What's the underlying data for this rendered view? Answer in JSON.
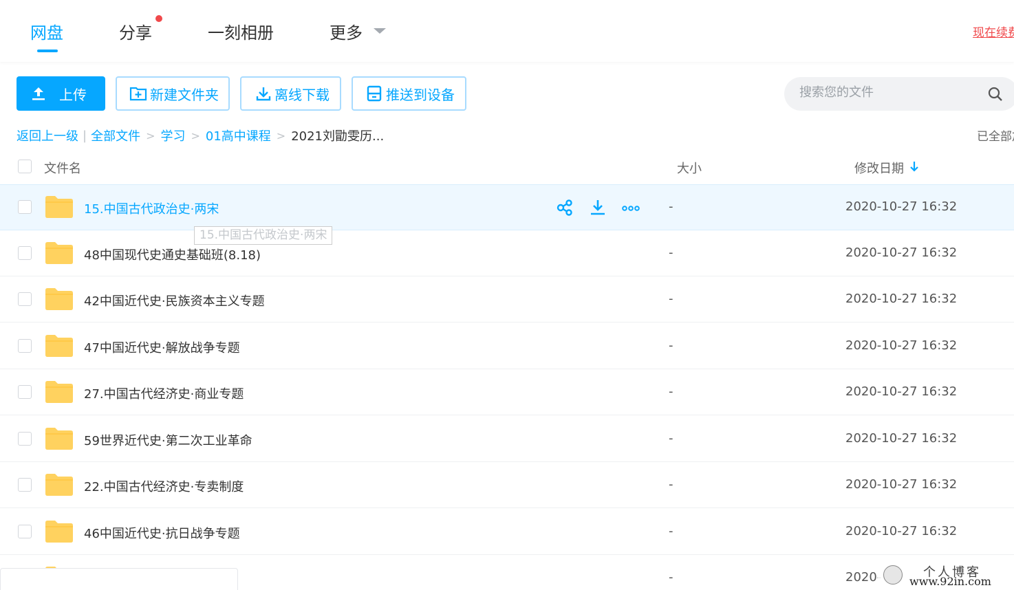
{
  "nav": {
    "tabs": [
      {
        "label": "网盘"
      },
      {
        "label": "分享"
      },
      {
        "label": "一刻相册"
      },
      {
        "label": "更多"
      }
    ],
    "renew_link": "现在续费"
  },
  "toolbar": {
    "upload": "上传",
    "new_folder": "新建文件夹",
    "offline_download": "离线下载",
    "push_device": "推送到设备"
  },
  "search": {
    "placeholder": "搜索您的文件"
  },
  "breadcrumb": {
    "back": "返回上一级",
    "items": [
      "全部文件",
      "学习",
      "01高中课程"
    ],
    "current": "2021刘勖雯历..."
  },
  "loaded_status": "已全部加载",
  "table": {
    "headers": {
      "name": "文件名",
      "size": "大小",
      "modified": "修改日期"
    },
    "rows": [
      {
        "name": "15.中国古代政治史·两宋",
        "size": "-",
        "modified": "2020-10-27 16:32"
      },
      {
        "name": "48中国现代史通史基础班(8.18)",
        "size": "-",
        "modified": "2020-10-27 16:32"
      },
      {
        "name": "42中国近代史·民族资本主义专题",
        "size": "-",
        "modified": "2020-10-27 16:32"
      },
      {
        "name": "47中国近代史·解放战争专题",
        "size": "-",
        "modified": "2020-10-27 16:32"
      },
      {
        "name": "27.中国古代经济史·商业专题",
        "size": "-",
        "modified": "2020-10-27 16:32"
      },
      {
        "name": "59世界近代史·第二次工业革命",
        "size": "-",
        "modified": "2020-10-27 16:32"
      },
      {
        "name": "22.中国古代经济史·专卖制度",
        "size": "-",
        "modified": "2020-10-27 16:32"
      },
      {
        "name": "46中国近代史·抗日战争专题",
        "size": "-",
        "modified": "2020-10-27 16:32"
      },
      {
        "name": "",
        "size": "-",
        "modified": "2020-"
      }
    ]
  },
  "tooltip": "15.中国古代政治史·两宋",
  "watermark": {
    "title": "个人博客",
    "url": "www.92in.com"
  },
  "colors": {
    "accent": "#06a7ff",
    "alert": "#f0494b",
    "folder": "#ffd25f"
  }
}
